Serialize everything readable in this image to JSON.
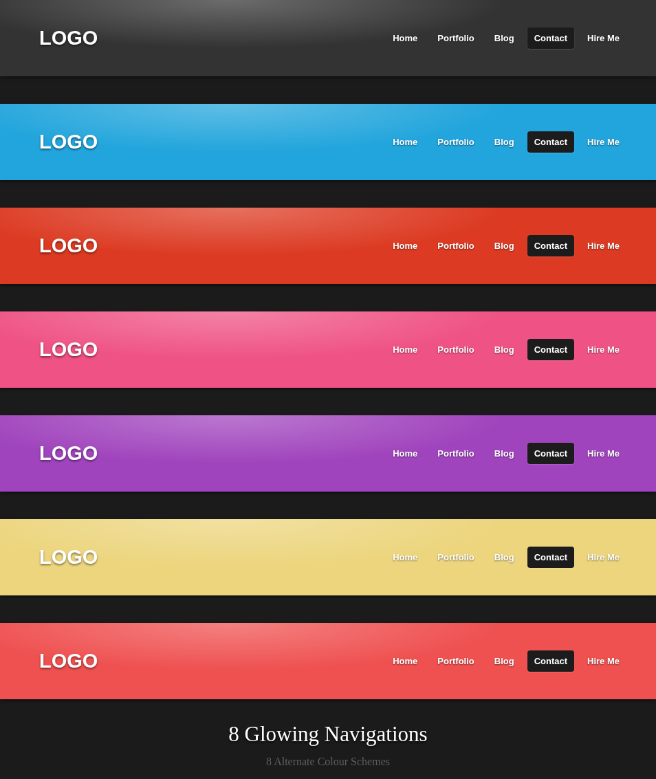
{
  "bars": [
    {
      "color": "#333333",
      "logo": "LOGO",
      "nav": [
        {
          "label": "Home",
          "selected": false
        },
        {
          "label": "Portfolio",
          "selected": false
        },
        {
          "label": "Blog",
          "selected": false
        },
        {
          "label": "Contact",
          "selected": true
        },
        {
          "label": "Hire Me",
          "selected": false
        }
      ]
    },
    {
      "color": "#22a5dc",
      "logo": "LOGO",
      "nav": [
        {
          "label": "Home",
          "selected": false
        },
        {
          "label": "Portfolio",
          "selected": false
        },
        {
          "label": "Blog",
          "selected": false
        },
        {
          "label": "Contact",
          "selected": true
        },
        {
          "label": "Hire Me",
          "selected": false
        }
      ]
    },
    {
      "color": "#dc3a22",
      "logo": "LOGO",
      "nav": [
        {
          "label": "Home",
          "selected": false
        },
        {
          "label": "Portfolio",
          "selected": false
        },
        {
          "label": "Blog",
          "selected": false
        },
        {
          "label": "Contact",
          "selected": true
        },
        {
          "label": "Hire Me",
          "selected": false
        }
      ]
    },
    {
      "color": "#ef5285",
      "logo": "LOGO",
      "nav": [
        {
          "label": "Home",
          "selected": false
        },
        {
          "label": "Portfolio",
          "selected": false
        },
        {
          "label": "Blog",
          "selected": false
        },
        {
          "label": "Contact",
          "selected": true
        },
        {
          "label": "Hire Me",
          "selected": false
        }
      ]
    },
    {
      "color": "#a044bd",
      "logo": "LOGO",
      "nav": [
        {
          "label": "Home",
          "selected": false
        },
        {
          "label": "Portfolio",
          "selected": false
        },
        {
          "label": "Blog",
          "selected": false
        },
        {
          "label": "Contact",
          "selected": true
        },
        {
          "label": "Hire Me",
          "selected": false
        }
      ]
    },
    {
      "color": "#ecd57d",
      "logo": "LOGO",
      "nav": [
        {
          "label": "Home",
          "selected": false
        },
        {
          "label": "Portfolio",
          "selected": false
        },
        {
          "label": "Blog",
          "selected": false
        },
        {
          "label": "Contact",
          "selected": true
        },
        {
          "label": "Hire Me",
          "selected": false
        }
      ]
    },
    {
      "color": "#ef5050",
      "logo": "LOGO",
      "nav": [
        {
          "label": "Home",
          "selected": false
        },
        {
          "label": "Portfolio",
          "selected": false
        },
        {
          "label": "Blog",
          "selected": false
        },
        {
          "label": "Contact",
          "selected": true
        },
        {
          "label": "Hire Me",
          "selected": false
        }
      ]
    }
  ],
  "footer": {
    "title": "8 Glowing Navigations",
    "subtitle": "8 Alternate Colour Schemes"
  }
}
